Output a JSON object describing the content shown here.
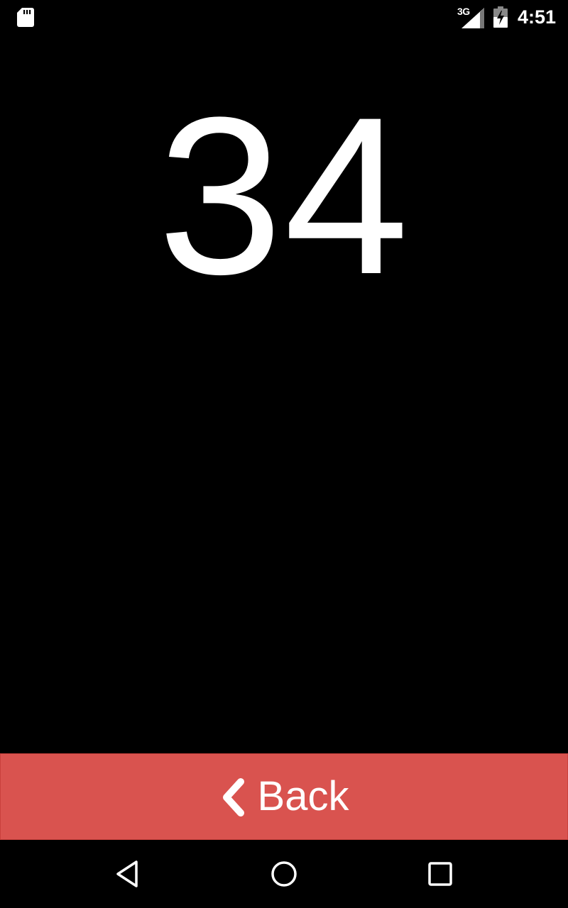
{
  "status_bar": {
    "network_type": "3G",
    "time": "4:51",
    "icons": [
      "sd-card-icon",
      "cell-signal-icon",
      "battery-charging-icon"
    ]
  },
  "main": {
    "number": "34"
  },
  "back_button": {
    "label": "Back",
    "icon": "chevron-left-icon",
    "color": "#d9534f"
  },
  "nav_bar": {
    "icons": [
      "nav-back-icon",
      "nav-home-icon",
      "nav-recents-icon"
    ]
  }
}
